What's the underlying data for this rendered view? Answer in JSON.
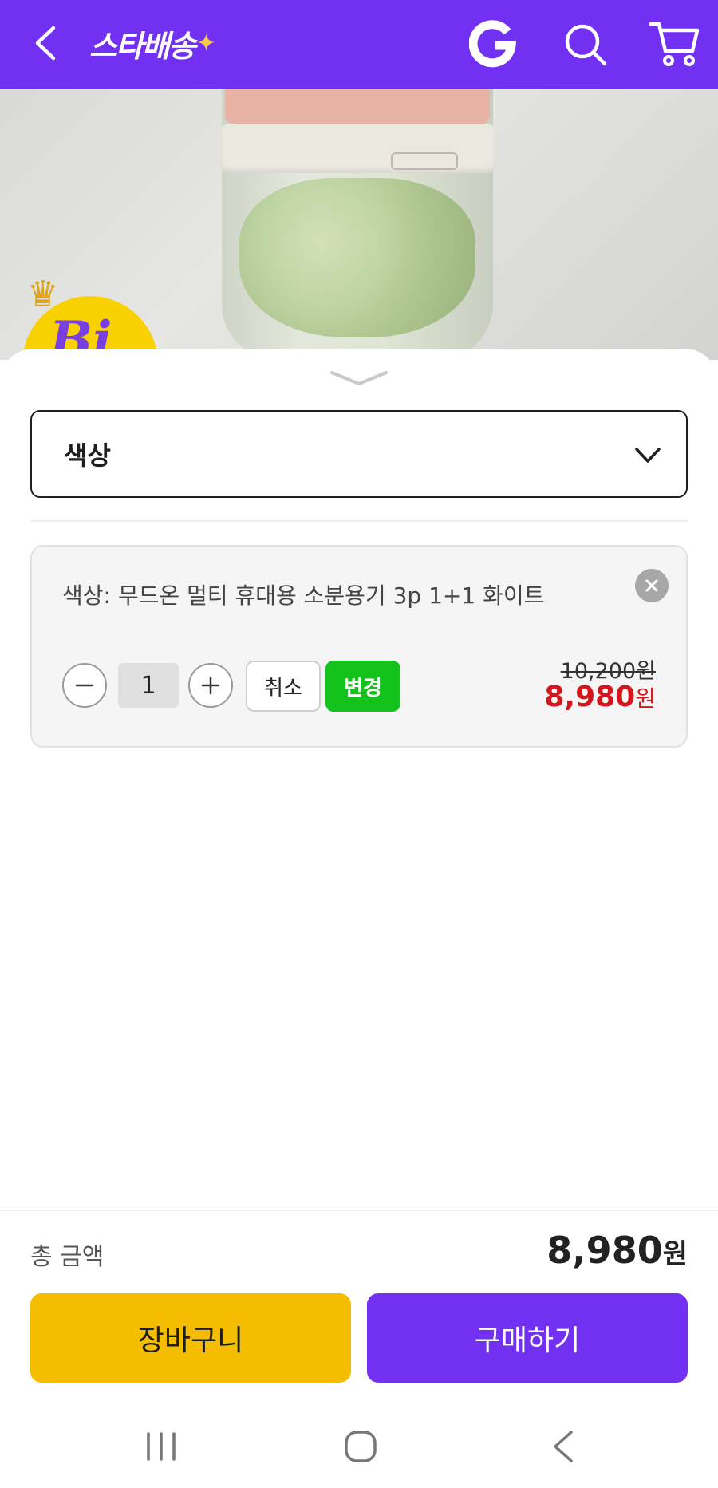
{
  "header": {
    "logo_text": "스타배송",
    "logo_spark": "✦",
    "colors": {
      "brand": "#7230f2",
      "spark": "#f7c94a"
    },
    "icons": [
      "back-arrow-icon",
      "g-icon",
      "search-icon",
      "cart-icon"
    ]
  },
  "product_image": {
    "badge_text": "Bi"
  },
  "sheet": {
    "select": {
      "label": "색상"
    },
    "option": {
      "name": "색상: 무드온 멀티 휴대용 소분용기 3p 1+1 화이트",
      "quantity": "1",
      "cancel_label": "취소",
      "change_label": "변경",
      "price_original": "10,200원",
      "price_sale_number": "8,980",
      "price_sale_unit": "원"
    }
  },
  "footer": {
    "total_label": "총 금액",
    "total_number": "8,980",
    "total_unit": "원",
    "cart_label": "장바구니",
    "buy_label": "구매하기",
    "colors": {
      "cart": "#f5bd00",
      "buy": "#7230f2",
      "change": "#13c21c",
      "sale_price": "#d6141c"
    }
  },
  "navbar": {
    "icons": [
      "recent-apps-icon",
      "home-icon",
      "nav-back-icon"
    ]
  }
}
